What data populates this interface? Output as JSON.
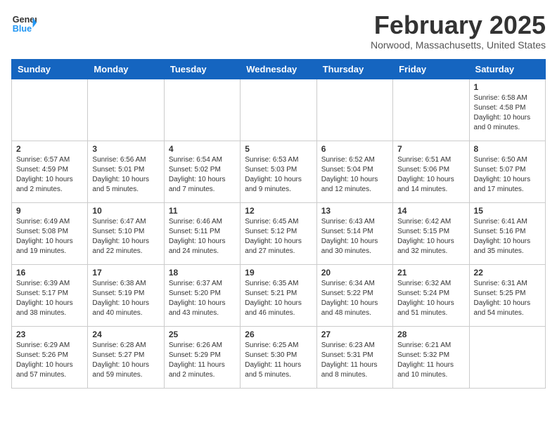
{
  "header": {
    "logo_line1": "General",
    "logo_line2": "Blue",
    "month_year": "February 2025",
    "location": "Norwood, Massachusetts, United States"
  },
  "weekdays": [
    "Sunday",
    "Monday",
    "Tuesday",
    "Wednesday",
    "Thursday",
    "Friday",
    "Saturday"
  ],
  "weeks": [
    [
      {
        "day": "",
        "info": ""
      },
      {
        "day": "",
        "info": ""
      },
      {
        "day": "",
        "info": ""
      },
      {
        "day": "",
        "info": ""
      },
      {
        "day": "",
        "info": ""
      },
      {
        "day": "",
        "info": ""
      },
      {
        "day": "1",
        "info": "Sunrise: 6:58 AM\nSunset: 4:58 PM\nDaylight: 10 hours and 0 minutes."
      }
    ],
    [
      {
        "day": "2",
        "info": "Sunrise: 6:57 AM\nSunset: 4:59 PM\nDaylight: 10 hours and 2 minutes."
      },
      {
        "day": "3",
        "info": "Sunrise: 6:56 AM\nSunset: 5:01 PM\nDaylight: 10 hours and 5 minutes."
      },
      {
        "day": "4",
        "info": "Sunrise: 6:54 AM\nSunset: 5:02 PM\nDaylight: 10 hours and 7 minutes."
      },
      {
        "day": "5",
        "info": "Sunrise: 6:53 AM\nSunset: 5:03 PM\nDaylight: 10 hours and 9 minutes."
      },
      {
        "day": "6",
        "info": "Sunrise: 6:52 AM\nSunset: 5:04 PM\nDaylight: 10 hours and 12 minutes."
      },
      {
        "day": "7",
        "info": "Sunrise: 6:51 AM\nSunset: 5:06 PM\nDaylight: 10 hours and 14 minutes."
      },
      {
        "day": "8",
        "info": "Sunrise: 6:50 AM\nSunset: 5:07 PM\nDaylight: 10 hours and 17 minutes."
      }
    ],
    [
      {
        "day": "9",
        "info": "Sunrise: 6:49 AM\nSunset: 5:08 PM\nDaylight: 10 hours and 19 minutes."
      },
      {
        "day": "10",
        "info": "Sunrise: 6:47 AM\nSunset: 5:10 PM\nDaylight: 10 hours and 22 minutes."
      },
      {
        "day": "11",
        "info": "Sunrise: 6:46 AM\nSunset: 5:11 PM\nDaylight: 10 hours and 24 minutes."
      },
      {
        "day": "12",
        "info": "Sunrise: 6:45 AM\nSunset: 5:12 PM\nDaylight: 10 hours and 27 minutes."
      },
      {
        "day": "13",
        "info": "Sunrise: 6:43 AM\nSunset: 5:14 PM\nDaylight: 10 hours and 30 minutes."
      },
      {
        "day": "14",
        "info": "Sunrise: 6:42 AM\nSunset: 5:15 PM\nDaylight: 10 hours and 32 minutes."
      },
      {
        "day": "15",
        "info": "Sunrise: 6:41 AM\nSunset: 5:16 PM\nDaylight: 10 hours and 35 minutes."
      }
    ],
    [
      {
        "day": "16",
        "info": "Sunrise: 6:39 AM\nSunset: 5:17 PM\nDaylight: 10 hours and 38 minutes."
      },
      {
        "day": "17",
        "info": "Sunrise: 6:38 AM\nSunset: 5:19 PM\nDaylight: 10 hours and 40 minutes."
      },
      {
        "day": "18",
        "info": "Sunrise: 6:37 AM\nSunset: 5:20 PM\nDaylight: 10 hours and 43 minutes."
      },
      {
        "day": "19",
        "info": "Sunrise: 6:35 AM\nSunset: 5:21 PM\nDaylight: 10 hours and 46 minutes."
      },
      {
        "day": "20",
        "info": "Sunrise: 6:34 AM\nSunset: 5:22 PM\nDaylight: 10 hours and 48 minutes."
      },
      {
        "day": "21",
        "info": "Sunrise: 6:32 AM\nSunset: 5:24 PM\nDaylight: 10 hours and 51 minutes."
      },
      {
        "day": "22",
        "info": "Sunrise: 6:31 AM\nSunset: 5:25 PM\nDaylight: 10 hours and 54 minutes."
      }
    ],
    [
      {
        "day": "23",
        "info": "Sunrise: 6:29 AM\nSunset: 5:26 PM\nDaylight: 10 hours and 57 minutes."
      },
      {
        "day": "24",
        "info": "Sunrise: 6:28 AM\nSunset: 5:27 PM\nDaylight: 10 hours and 59 minutes."
      },
      {
        "day": "25",
        "info": "Sunrise: 6:26 AM\nSunset: 5:29 PM\nDaylight: 11 hours and 2 minutes."
      },
      {
        "day": "26",
        "info": "Sunrise: 6:25 AM\nSunset: 5:30 PM\nDaylight: 11 hours and 5 minutes."
      },
      {
        "day": "27",
        "info": "Sunrise: 6:23 AM\nSunset: 5:31 PM\nDaylight: 11 hours and 8 minutes."
      },
      {
        "day": "28",
        "info": "Sunrise: 6:21 AM\nSunset: 5:32 PM\nDaylight: 11 hours and 10 minutes."
      },
      {
        "day": "",
        "info": ""
      }
    ]
  ]
}
